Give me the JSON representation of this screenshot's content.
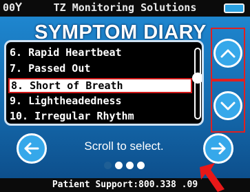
{
  "status_bar": {
    "signal_text": "00",
    "signal_icon": "signal-antenna-icon",
    "title": "TZ Monitoring Solutions",
    "battery_icon": "battery-icon"
  },
  "page": {
    "title": "SYMPTOM DIARY"
  },
  "list": {
    "items": [
      {
        "label": "6. Rapid Heartbeat",
        "selected": false
      },
      {
        "label": "7. Passed Out",
        "selected": false
      },
      {
        "label": "8. Short of Breath",
        "selected": true
      },
      {
        "label": "9. Lightheadedness",
        "selected": false
      },
      {
        "label": "10. Irregular Rhythm",
        "selected": false
      }
    ],
    "scroll_position": 0.35
  },
  "controls": {
    "scroll_up_icon": "chevron-up-icon",
    "scroll_down_icon": "chevron-down-icon",
    "back_icon": "arrow-left-icon",
    "next_icon": "arrow-right-icon"
  },
  "hint": {
    "text": "Scroll to select."
  },
  "pagination": {
    "total": 4,
    "current": 1
  },
  "footer": {
    "support_text": "Patient Support:800.338  .09"
  },
  "colors": {
    "accent": "#36a8ea",
    "highlight_border": "#d01818",
    "background": "#1a7ac0",
    "bar": "#0b0b0b"
  }
}
